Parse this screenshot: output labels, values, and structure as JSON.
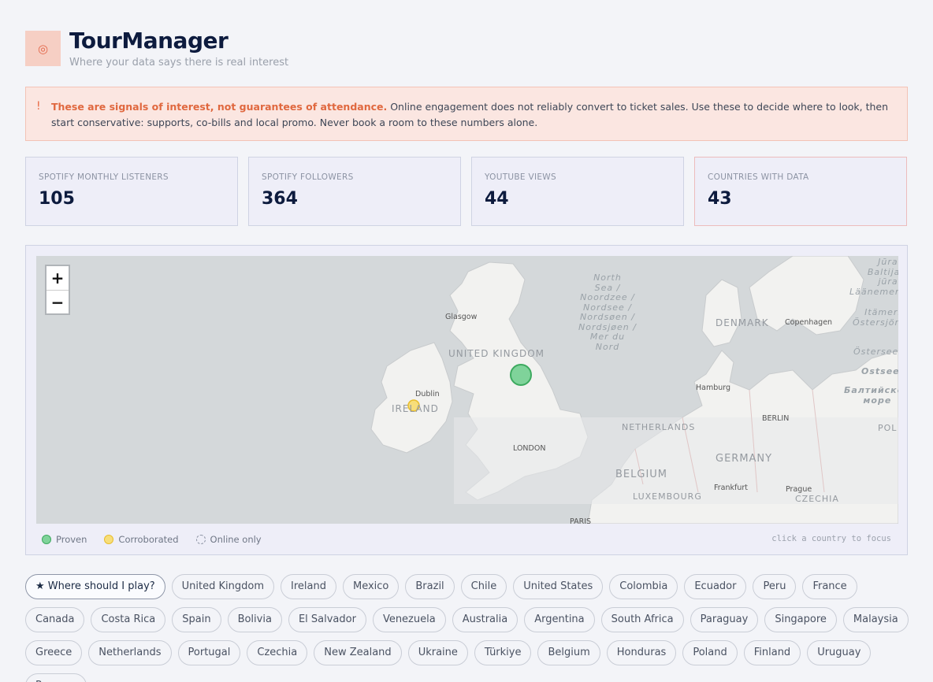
{
  "app": {
    "title": "TourManager",
    "subtitle": "Where your data says there is real interest",
    "logo_icon": "◎",
    "accent_color": "#e3674a"
  },
  "warning": {
    "icon": "!",
    "strong": "These are signals of interest, not guarantees of attendance.",
    "body": "Online engagement does not reliably convert to ticket sales. Use these to decide where to look, then start conservative: supports, co-bills and local promo. Never book a room to these numbers alone."
  },
  "stats": [
    {
      "label": "SPOTIFY MONTHLY LISTENERS",
      "value": "105"
    },
    {
      "label": "SPOTIFY FOLLOWERS",
      "value": "364"
    },
    {
      "label": "YOUTUBE VIEWS",
      "value": "44"
    },
    {
      "label": "COUNTRIES WITH DATA",
      "value": "43"
    }
  ],
  "map": {
    "zoom_in": "+",
    "zoom_out": "−",
    "labels": {
      "uk": "UNITED KINGDOM",
      "ireland": "IRELAND",
      "denmark": "DENMARK",
      "netherlands": "NETHERLANDS",
      "germany": "GERMANY",
      "belgium": "BELGIUM",
      "luxembourg": "LUXEMBOURG",
      "czechia": "CZECHIA",
      "glasgow": "Glasgow",
      "dublin": "Dublin",
      "london": "LONDON",
      "hamburg": "Hamburg",
      "berlin": "BERLIN",
      "copenhagen": "Copenhagen",
      "frankfurt": "Frankfurt",
      "prague": "Prague",
      "paris": "PARIS",
      "pol": "POL",
      "north_sea": "North\nSea /\nNoordzee /\nNordsee /\nNordsøen /\nNordsjøen /\nMer du\nNord",
      "baltic_top": "Jūra -\nBaltijas\njūra -\nLäänemere",
      "baltic_mid": "Itämeri\nÖstersjön",
      "ostsee": "Ostsee",
      "baltic_ru": "Балтийское\nморе",
      "ostersee2": "Östersee"
    },
    "markers": [
      {
        "country": "United Kingdom",
        "status": "proven",
        "color": "#58c27a"
      },
      {
        "country": "Ireland",
        "status": "corroborated",
        "color": "#f5d25f"
      }
    ]
  },
  "legend": [
    {
      "label": "Proven",
      "color": "#4fbf72"
    },
    {
      "label": "Corroborated",
      "color": "#f5cf5a"
    },
    {
      "label": "Online only",
      "color": "none"
    }
  ],
  "hint": "click a country to focus",
  "chips": [
    "★ Where should I play?",
    "United Kingdom",
    "Ireland",
    "Mexico",
    "Brazil",
    "Chile",
    "United States",
    "Colombia",
    "Ecuador",
    "Peru",
    "France",
    "Canada",
    "Costa Rica",
    "Spain",
    "Bolivia",
    "El Salvador",
    "Venezuela",
    "Australia",
    "Argentina",
    "South Africa",
    "Paraguay",
    "Singapore",
    "Malaysia",
    "Greece",
    "Netherlands",
    "Portugal",
    "Czechia",
    "New Zealand",
    "Ukraine",
    "Türkiye",
    "Belgium",
    "Honduras",
    "Poland",
    "Finland",
    "Uruguay",
    "Panama"
  ]
}
